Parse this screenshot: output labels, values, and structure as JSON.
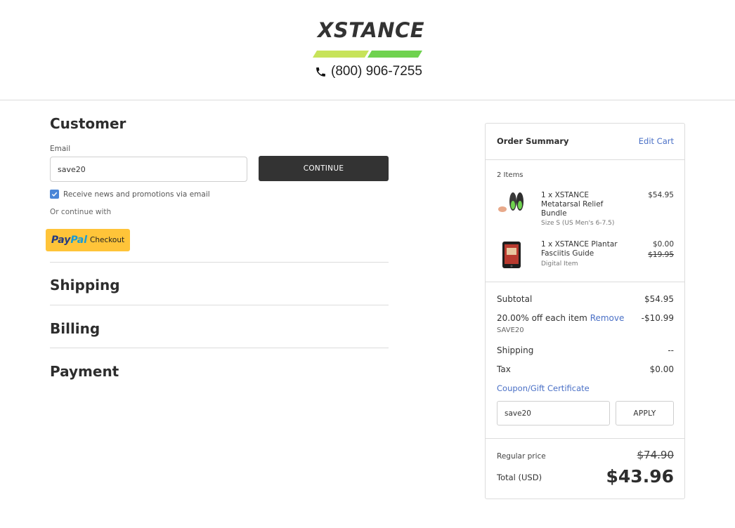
{
  "header": {
    "logo_text": "XSTANCE",
    "phone": "(800) 906-7255",
    "colors": {
      "stripe_light": "#c7e35a",
      "stripe_green": "#6fd24f"
    }
  },
  "customer": {
    "title": "Customer",
    "email_label": "Email",
    "email_value": "save20",
    "continue_label": "CONTINUE",
    "newsletter_label": "Receive news and promotions via email",
    "newsletter_checked": true,
    "or_continue": "Or continue with",
    "paypal_pay": "Pay",
    "paypal_pal": "Pal",
    "paypal_checkout": "Checkout"
  },
  "sections": {
    "shipping": "Shipping",
    "billing": "Billing",
    "payment": "Payment"
  },
  "summary": {
    "title": "Order Summary",
    "edit_cart": "Edit Cart",
    "items_count": "2 Items",
    "items": [
      {
        "name_line1": "1 x XSTANCE",
        "name_line2": "Metatarsal Relief",
        "name_line3": "Bundle",
        "sub": "Size S (US Men's 6-7.5)",
        "price": "$54.95"
      },
      {
        "name_line1": "1 x XSTANCE Plantar",
        "name_line2": "Fasciitis Guide",
        "sub": "Digital Item",
        "price": "$0.00",
        "original_price": "$19.95"
      }
    ],
    "subtotal_label": "Subtotal",
    "subtotal_value": "$54.95",
    "discount_label": "20.00% off each item",
    "discount_remove": "Remove",
    "discount_value": "-$10.99",
    "discount_code": "SAVE20",
    "shipping_label": "Shipping",
    "shipping_value": "--",
    "tax_label": "Tax",
    "tax_value": "$0.00",
    "coupon_link": "Coupon/Gift Certificate",
    "coupon_value": "save20",
    "apply_label": "APPLY",
    "regular_price_label": "Regular price",
    "regular_price_value": "$74.90",
    "total_label": "Total (USD)",
    "total_value": "$43.96"
  }
}
